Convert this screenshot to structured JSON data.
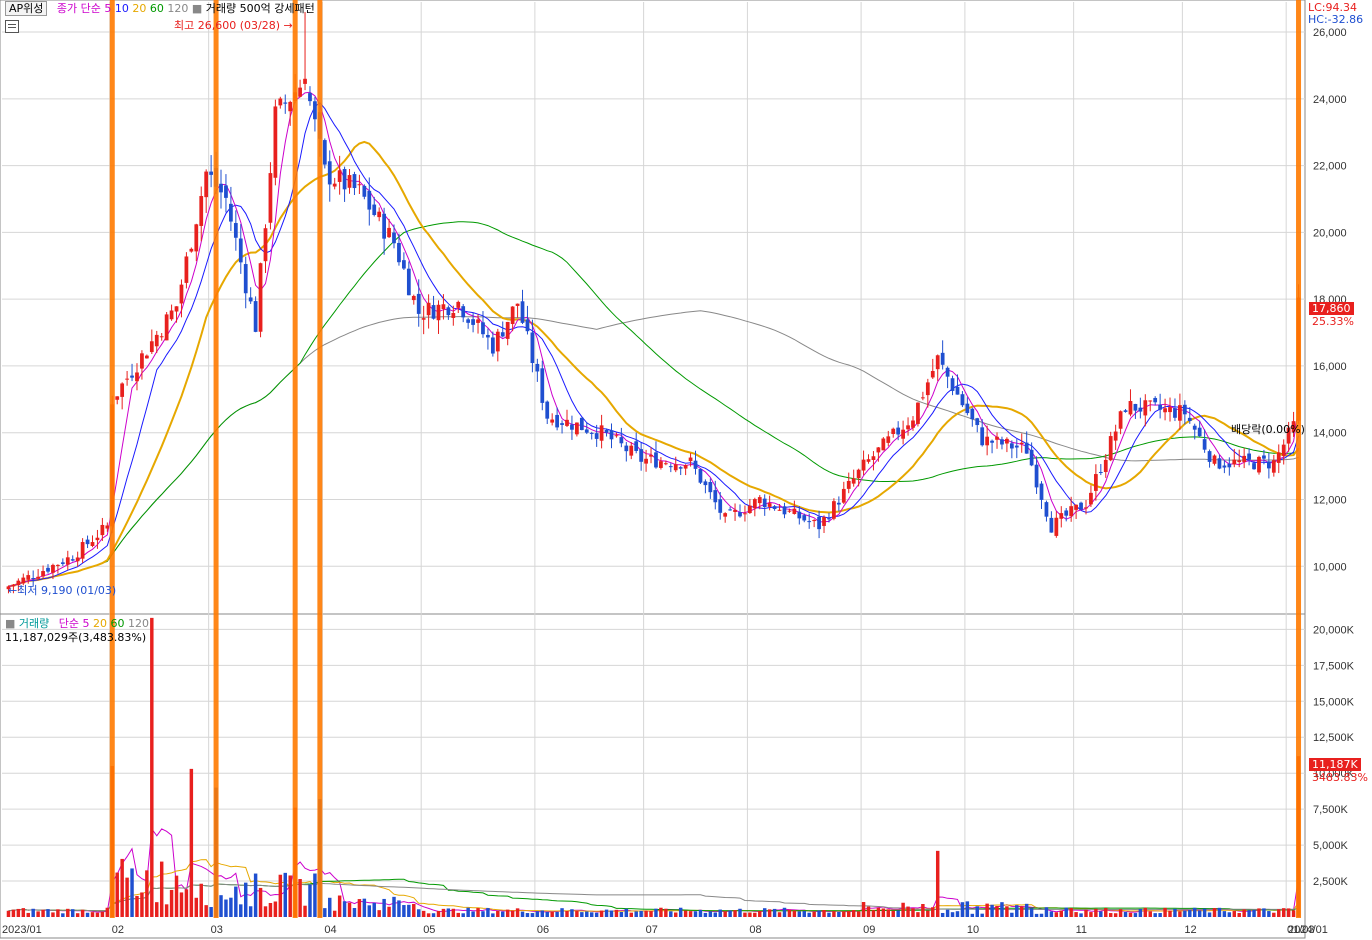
{
  "price_header": {
    "indicator_label": "AP위성",
    "ma_label": "종가 단순",
    "ma_periods": [
      {
        "p": "5",
        "color": "#cc00cc"
      },
      {
        "p": "10",
        "color": "#1a1aff"
      },
      {
        "p": "20",
        "color": "#e6a800"
      },
      {
        "p": "60",
        "color": "#009900"
      },
      {
        "p": "120",
        "color": "#888888"
      }
    ],
    "pattern_label": "거래량 500억 강세패턴",
    "lc": "LC:94.34",
    "hc": "HC:-32.86"
  },
  "volume_header": {
    "label": "거래량",
    "ma_label": "단순",
    "ma_periods": [
      {
        "p": "5",
        "color": "#cc00cc"
      },
      {
        "p": "20",
        "color": "#e6a800"
      },
      {
        "p": "60",
        "color": "#009900"
      },
      {
        "p": "120",
        "color": "#888888"
      }
    ],
    "value_text": "11,187,029주(3,483.83%)"
  },
  "annotations": {
    "high": "최고 26,600 (03/28)",
    "low": "최저 9,190 (01/03)",
    "dividend": "배당락(0.00%)"
  },
  "current": {
    "price": "17,860",
    "change": "25.33%",
    "volume": "11,187K",
    "volume_ratio": "3483.83%"
  },
  "colors": {
    "up": "#e8201e",
    "down": "#1f4fd0",
    "highlight": "#ff7a00",
    "ma5": "#cc00cc",
    "ma10": "#1a1aff",
    "ma20": "#e6a800",
    "ma60": "#009900",
    "ma120": "#888888",
    "grid": "#d6d6d6",
    "axis_text": "#333333"
  },
  "chart_data": {
    "type": "candlestick",
    "price_axis": {
      "ticks": [
        "10,000",
        "12,000",
        "14,000",
        "16,000",
        "18,000",
        "20,000",
        "22,000",
        "24,000",
        "26,000"
      ],
      "ylim": [
        8600,
        26900
      ]
    },
    "volume_axis": {
      "ticks": [
        "2,500K",
        "5,000K",
        "7,500K",
        "10,000K",
        "12,500K",
        "15,000K",
        "17,500K",
        "20,000K"
      ],
      "ylim": [
        0,
        21000
      ]
    },
    "x_axis": {
      "labels": [
        "2023/01",
        "02",
        "03",
        "04",
        "05",
        "06",
        "07",
        "08",
        "09",
        "10",
        "11",
        "12",
        "2024/01",
        "01/03"
      ]
    },
    "month_starts": [
      "2023/01",
      "02",
      "03",
      "04",
      "05",
      "06",
      "07",
      "08",
      "09",
      "10",
      "11",
      "12",
      "2024/01"
    ],
    "keypoints": [
      {
        "date": "2023-01-03",
        "close": 9400
      },
      {
        "date": "2023-01-20",
        "close": 10300
      },
      {
        "date": "2023-01-31",
        "close": 11200
      },
      {
        "date": "2023-02-01",
        "close": 15000
      },
      {
        "date": "2023-02-10",
        "close": 16500
      },
      {
        "date": "2023-02-20",
        "close": 17800
      },
      {
        "date": "2023-02-28",
        "close": 21800
      },
      {
        "date": "2023-03-06",
        "close": 21000
      },
      {
        "date": "2023-03-14",
        "close": 17200
      },
      {
        "date": "2023-03-20",
        "close": 23500
      },
      {
        "date": "2023-03-28",
        "close": 24600
      },
      {
        "date": "2023-04-03",
        "close": 21800
      },
      {
        "date": "2023-04-12",
        "close": 21200
      },
      {
        "date": "2023-04-21",
        "close": 19700
      },
      {
        "date": "2023-04-28",
        "close": 17600
      },
      {
        "date": "2023-05-10",
        "close": 17900
      },
      {
        "date": "2023-05-19",
        "close": 16600
      },
      {
        "date": "2023-05-26",
        "close": 17900
      },
      {
        "date": "2023-06-05",
        "close": 14500
      },
      {
        "date": "2023-06-20",
        "close": 14000
      },
      {
        "date": "2023-06-30",
        "close": 13200
      },
      {
        "date": "2023-07-14",
        "close": 13100
      },
      {
        "date": "2023-07-25",
        "close": 11400
      },
      {
        "date": "2023-08-03",
        "close": 12000
      },
      {
        "date": "2023-08-21",
        "close": 11200
      },
      {
        "date": "2023-09-01",
        "close": 13000
      },
      {
        "date": "2023-09-15",
        "close": 14500
      },
      {
        "date": "2023-09-22",
        "close": 16200
      },
      {
        "date": "2023-10-05",
        "close": 13800
      },
      {
        "date": "2023-10-18",
        "close": 13500
      },
      {
        "date": "2023-10-25",
        "close": 11200
      },
      {
        "date": "2023-11-03",
        "close": 11900
      },
      {
        "date": "2023-11-15",
        "close": 14800
      },
      {
        "date": "2023-12-01",
        "close": 14600
      },
      {
        "date": "2023-12-10",
        "close": 13100
      },
      {
        "date": "2023-12-27",
        "close": 13100
      },
      {
        "date": "2024-01-02",
        "close": 14200
      },
      {
        "date": "2024-01-03",
        "close": 17860
      }
    ],
    "period_high": {
      "value": 26600,
      "date": "03/28"
    },
    "period_low": {
      "value": 9190,
      "date": "01/03"
    },
    "volume_spikes": [
      {
        "date": "2023-02-01",
        "value": 10500
      },
      {
        "date": "2023-02-13",
        "value": 20800
      },
      {
        "date": "2023-02-23",
        "value": 10300
      },
      {
        "date": "2023-03-02",
        "value": 9000
      },
      {
        "date": "2023-03-24",
        "value": 7600
      },
      {
        "date": "2023-03-31",
        "value": 8200
      },
      {
        "date": "2023-09-22",
        "value": 4600
      },
      {
        "date": "2024-01-03",
        "value": 11187
      }
    ],
    "highlight_dates": [
      "2023-02-01",
      "2023-03-02",
      "2023-03-24",
      "2023-03-31",
      "2024-01-03"
    ],
    "series": [
      {
        "name": "5",
        "kind": "ma"
      },
      {
        "name": "10",
        "kind": "ma"
      },
      {
        "name": "20",
        "kind": "ma"
      },
      {
        "name": "60",
        "kind": "ma"
      },
      {
        "name": "120",
        "kind": "ma"
      }
    ]
  }
}
